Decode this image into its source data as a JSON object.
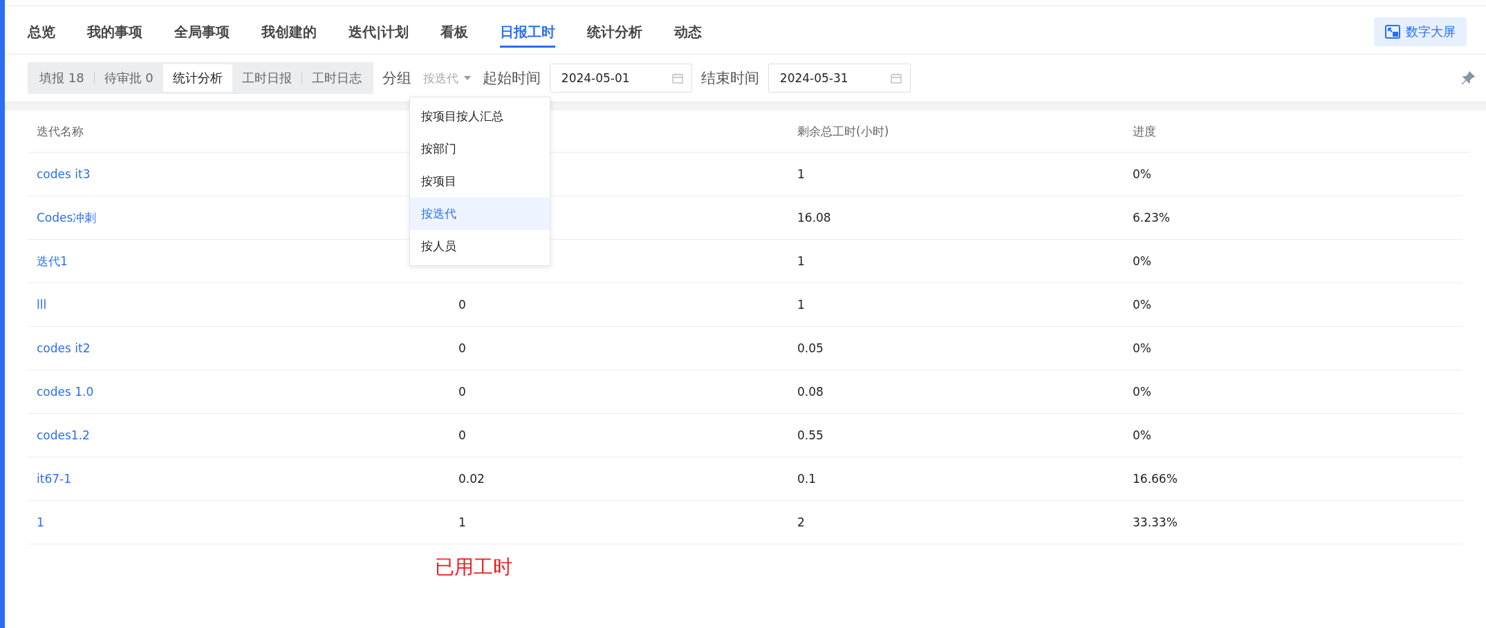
{
  "nav": {
    "tabs": [
      {
        "label": "总览",
        "selected": false
      },
      {
        "label": "我的事项",
        "selected": false
      },
      {
        "label": "全局事项",
        "selected": false
      },
      {
        "label": "我创建的",
        "selected": false
      },
      {
        "label": "迭代|计划",
        "selected": false
      },
      {
        "label": "看板",
        "selected": false
      },
      {
        "label": "日报工时",
        "selected": true
      },
      {
        "label": "统计分析",
        "selected": false
      },
      {
        "label": "动态",
        "selected": false
      }
    ],
    "screen_button": "数字大屏"
  },
  "toolbar": {
    "segments": [
      {
        "label": "填报 18",
        "selected": false
      },
      {
        "label": "待审批 0",
        "selected": false
      },
      {
        "label": "统计分析",
        "selected": true
      },
      {
        "label": "工时日报",
        "selected": false
      },
      {
        "label": "工时日志",
        "selected": false
      }
    ],
    "group_label": "分组",
    "group_select": {
      "value": "按迭代",
      "expanded": true,
      "options": [
        {
          "label": "按项目按人汇总",
          "selected": false
        },
        {
          "label": "按部门",
          "selected": false
        },
        {
          "label": "按项目",
          "selected": false
        },
        {
          "label": "按迭代",
          "selected": true
        },
        {
          "label": "按人员",
          "selected": false
        }
      ]
    },
    "start_label": "起始时间",
    "start_date": "2024-05-01",
    "end_label": "结束时间",
    "end_date": "2024-05-31"
  },
  "table": {
    "columns": [
      "迭代名称",
      "剩余总工时(小时)",
      "进度"
    ],
    "rows": [
      {
        "name": "codes it3",
        "remaining": "1",
        "progress": "0%"
      },
      {
        "name": "Codes冲刺",
        "remaining": "16.08",
        "progress": "6.23%"
      },
      {
        "name": "迭代1",
        "remaining": "1",
        "progress": "0%"
      },
      {
        "name": "lll",
        "used": "0",
        "remaining": "1",
        "progress": "0%"
      },
      {
        "name": "codes it2",
        "used": "0",
        "remaining": "0.05",
        "progress": "0%"
      },
      {
        "name": "codes 1.0",
        "used": "0",
        "remaining": "0.08",
        "progress": "0%"
      },
      {
        "name": "codes1.2",
        "used": "0",
        "remaining": "0.55",
        "progress": "0%"
      },
      {
        "name": "it67-1",
        "used": "0.02",
        "remaining": "0.1",
        "progress": "16.66%"
      },
      {
        "name": "1",
        "used": "1",
        "remaining": "2",
        "progress": "33.33%"
      }
    ]
  },
  "annotation": "已用工时"
}
